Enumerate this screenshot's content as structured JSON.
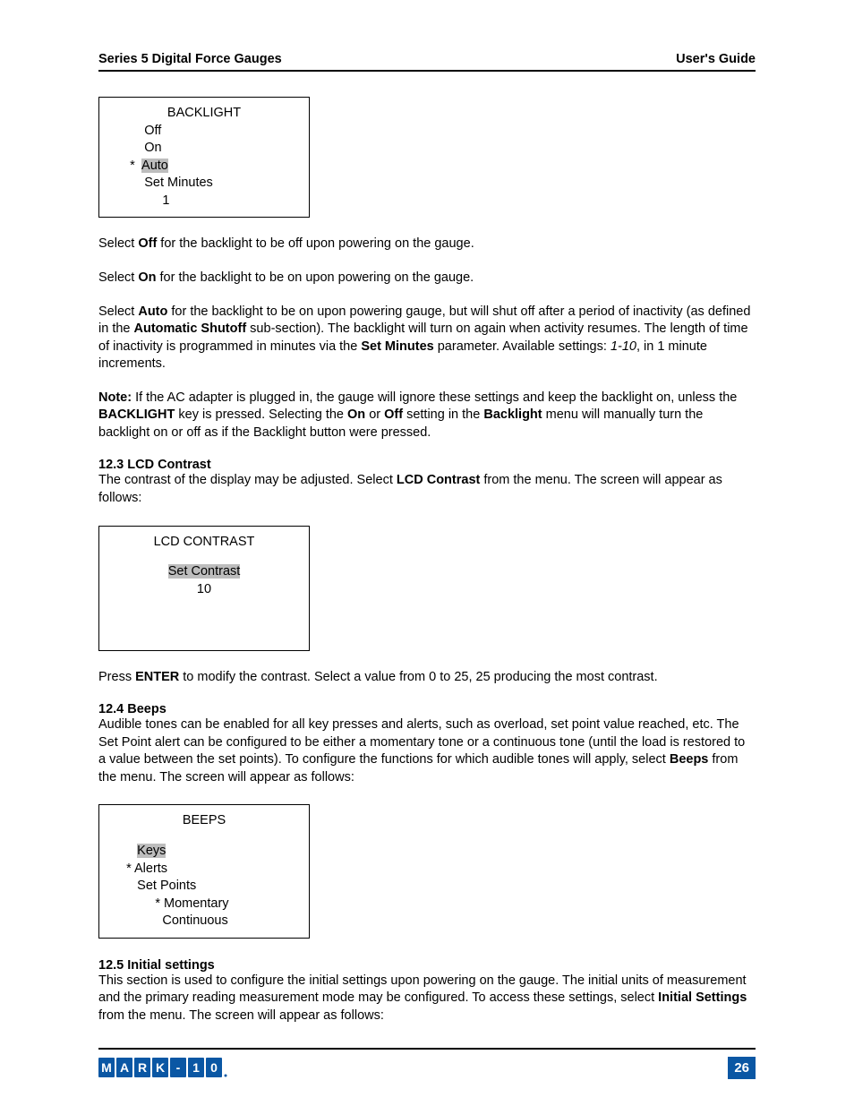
{
  "header": {
    "left": "Series 5 Digital Force Gauges",
    "right": "User's Guide"
  },
  "lcd_backlight": {
    "title": "BACKLIGHT",
    "off": "Off",
    "on": "On",
    "marker": "*",
    "auto": "Auto",
    "set_minutes_label": "Set Minutes",
    "set_minutes_value": "1"
  },
  "para_off_1": "Select ",
  "para_off_b": "Off",
  "para_off_2": " for the backlight to be off upon powering on the gauge.",
  "para_on_1": "Select ",
  "para_on_b": "On",
  "para_on_2": " for the backlight to be on upon powering on the gauge.",
  "para_auto_1": "Select ",
  "para_auto_b1": "Auto",
  "para_auto_2": " for the backlight to be on upon powering gauge, but will shut off after a period of inactivity (as defined in the ",
  "para_auto_b2": "Automatic Shutoff",
  "para_auto_3": " sub-section). The backlight will turn on again when activity resumes. The length of time of inactivity is programmed in minutes via the ",
  "para_auto_b3": "Set Minutes",
  "para_auto_4": " parameter. Available settings: ",
  "para_auto_i": "1-10",
  "para_auto_5": ", in 1 minute increments.",
  "note_b1": "Note:",
  "note_1": " If the AC adapter is plugged in, the gauge will ignore these settings and keep the backlight on, unless the ",
  "note_b2": "BACKLIGHT",
  "note_2": " key is pressed. Selecting the ",
  "note_b3": "On",
  "note_3": " or ",
  "note_b4": "Off",
  "note_4": " setting in the ",
  "note_b5": "Backlight",
  "note_5": " menu will manually turn the backlight on or off as if the Backlight button were pressed.",
  "sec_12_3_heading": "12.3 LCD Contrast",
  "sec_12_3_text_1": "The contrast of the display may be adjusted. Select ",
  "sec_12_3_b": "LCD Contrast",
  "sec_12_3_text_2": " from the menu. The screen will appear as follows:",
  "lcd_contrast": {
    "title": "LCD CONTRAST",
    "label": "Set Contrast",
    "value": "10"
  },
  "enter_1": "Press ",
  "enter_b": "ENTER",
  "enter_2": " to modify the contrast. Select a value from 0 to 25, 25 producing the most contrast.",
  "sec_12_4_heading": "12.4 Beeps",
  "sec_12_4_text_1": "Audible tones can be enabled for all key presses and alerts, such as overload, set point value reached, etc. The Set Point alert can be configured to be either a momentary tone or a continuous tone (until the load is restored to a value between the set points). To configure the functions for which audible tones will apply, select ",
  "sec_12_4_b": "Beeps",
  "sec_12_4_text_2": " from the menu. The screen will appear as follows:",
  "lcd_beeps": {
    "title": "BEEPS",
    "keys": "Keys",
    "alerts_star": "*",
    "alerts": "Alerts",
    "set_points": "Set Points",
    "momentary_star": "*",
    "momentary": "Momentary",
    "continuous": "Continuous"
  },
  "sec_12_5_heading": "12.5 Initial settings",
  "sec_12_5_text_1": "This section is used to configure the initial settings upon powering on the gauge. The initial units of measurement and the primary reading measurement mode may be configured. To access these settings, select ",
  "sec_12_5_b": "Initial Settings",
  "sec_12_5_text_2": " from the menu. The screen will appear as follows:",
  "page_number": "26"
}
